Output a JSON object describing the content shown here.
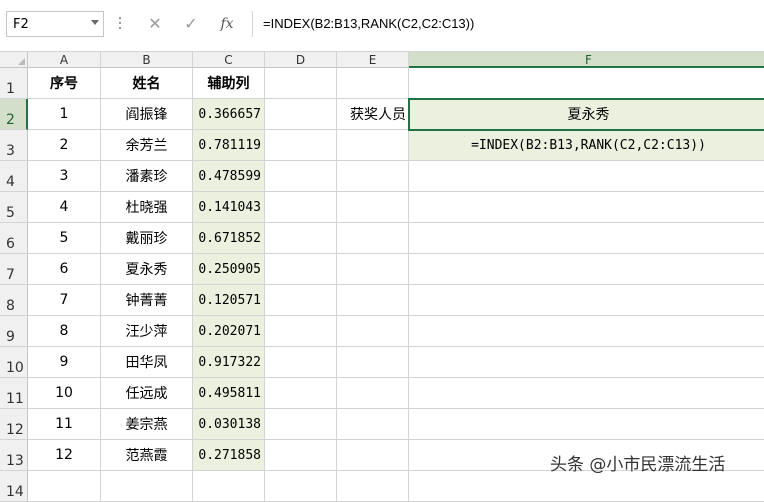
{
  "formula_bar": {
    "name_box": "F2",
    "cancel_icon": "✕",
    "enter_icon": "✓",
    "fx_label": "fx",
    "formula": "=INDEX(B2:B13,RANK(C2,C2:C13))"
  },
  "columns": [
    "A",
    "B",
    "C",
    "D",
    "E",
    "F"
  ],
  "selected_column": "F",
  "rows": [
    "1",
    "2",
    "3",
    "4",
    "5",
    "6",
    "7",
    "8",
    "9",
    "10",
    "11",
    "12",
    "13",
    "14"
  ],
  "selected_row": "2",
  "headers": {
    "a": "序号",
    "b": "姓名",
    "c": "辅助列"
  },
  "table": [
    {
      "no": "1",
      "name": "阎振锋",
      "aux": "0.366657"
    },
    {
      "no": "2",
      "name": "余芳兰",
      "aux": "0.781119"
    },
    {
      "no": "3",
      "name": "潘素珍",
      "aux": "0.478599"
    },
    {
      "no": "4",
      "name": "杜晓强",
      "aux": "0.141043"
    },
    {
      "no": "5",
      "name": "戴丽珍",
      "aux": "0.671852"
    },
    {
      "no": "6",
      "name": "夏永秀",
      "aux": "0.250905"
    },
    {
      "no": "7",
      "name": "钟菁菁",
      "aux": "0.120571"
    },
    {
      "no": "8",
      "name": "汪少萍",
      "aux": "0.202071"
    },
    {
      "no": "9",
      "name": "田华凤",
      "aux": "0.917322"
    },
    {
      "no": "10",
      "name": "任远成",
      "aux": "0.495811"
    },
    {
      "no": "11",
      "name": "姜宗燕",
      "aux": "0.030138"
    },
    {
      "no": "12",
      "name": "范燕霞",
      "aux": "0.271858"
    }
  ],
  "e2_label": "获奖人员",
  "f2_value": "夏永秀",
  "f3_formula_text": "=INDEX(B2:B13,RANK(C2,C2:C13))",
  "watermark": "头条 @小市民漂流生活",
  "colors": {
    "selection": "#217346",
    "aux_fill": "#ebf1de",
    "header_bg": "#f0f0f0"
  }
}
